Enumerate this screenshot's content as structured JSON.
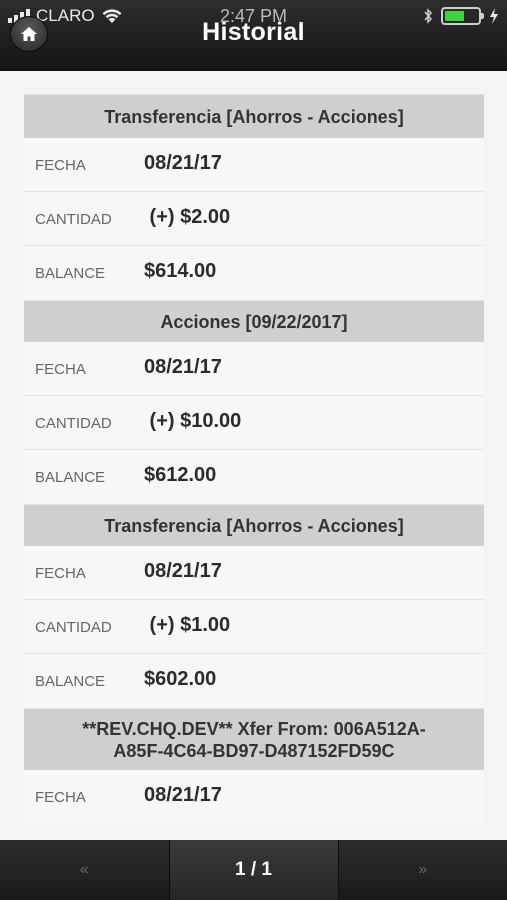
{
  "status_bar": {
    "carrier": "CLARO",
    "time": "2:47 PM",
    "battery_level": 0.6,
    "colors": {
      "battery": "#3dd53d"
    }
  },
  "header": {
    "title": "Historial",
    "home_icon": "home-icon"
  },
  "entries": [
    {
      "title": "Transferencia [Ahorros - Acciones]",
      "rows": [
        {
          "label": "FECHA",
          "value": "08/21/17"
        },
        {
          "label": "CANTIDAD",
          "value": " (+) $2.00"
        },
        {
          "label": "BALANCE",
          "value": "$614.00"
        }
      ]
    },
    {
      "title": "Acciones [09/22/2017]",
      "rows": [
        {
          "label": "FECHA",
          "value": "08/21/17"
        },
        {
          "label": "CANTIDAD",
          "value": " (+) $10.00"
        },
        {
          "label": "BALANCE",
          "value": "$612.00"
        }
      ]
    },
    {
      "title": "Transferencia [Ahorros - Acciones]",
      "rows": [
        {
          "label": "FECHA",
          "value": "08/21/17"
        },
        {
          "label": "CANTIDAD",
          "value": " (+) $1.00"
        },
        {
          "label": "BALANCE",
          "value": "$602.00"
        }
      ]
    },
    {
      "title": "**REV.CHQ.DEV** Xfer From: 006A512A-A85F-4C64-BD97-D487152FD59C",
      "rows": [
        {
          "label": "FECHA",
          "value": "08/21/17"
        }
      ]
    }
  ],
  "pagination": {
    "prev_label": "«",
    "page_label": "1 / 1",
    "next_label": "»"
  }
}
